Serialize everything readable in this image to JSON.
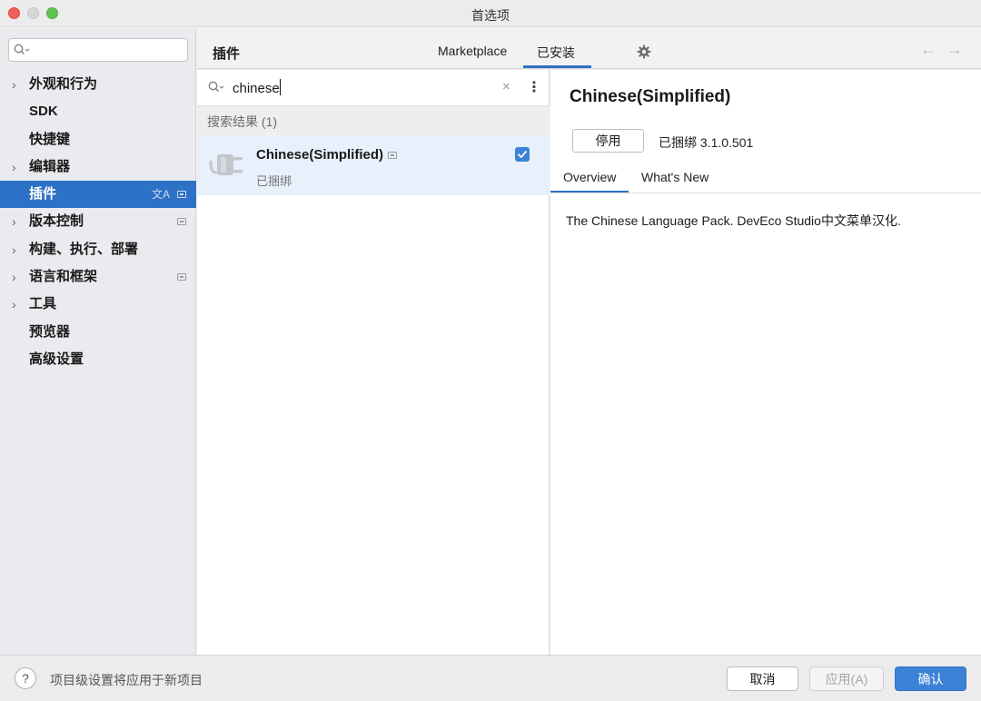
{
  "window": {
    "title": "首选项"
  },
  "sidebar": {
    "search": {
      "value": "",
      "placeholder": ""
    },
    "items": [
      {
        "label": "外观和行为",
        "expandable": true
      },
      {
        "label": "SDK",
        "expandable": false
      },
      {
        "label": "快捷键",
        "expandable": false
      },
      {
        "label": "编辑器",
        "expandable": true
      },
      {
        "label": "插件",
        "expandable": false,
        "selected": true
      },
      {
        "label": "版本控制",
        "expandable": true
      },
      {
        "label": "构建、执行、部署",
        "expandable": true
      },
      {
        "label": "语言和框架",
        "expandable": true
      },
      {
        "label": "工具",
        "expandable": true
      },
      {
        "label": "预览器",
        "expandable": false
      },
      {
        "label": "高级设置",
        "expandable": false
      }
    ]
  },
  "header": {
    "title": "插件",
    "tabs": [
      {
        "label": "Marketplace",
        "active": false
      },
      {
        "label": "已安装",
        "active": true
      }
    ]
  },
  "plugin_list": {
    "search_value": "chinese",
    "results_label": "搜索结果 (1)",
    "items": [
      {
        "name": "Chinese(Simplified)",
        "status": "已捆绑",
        "enabled": true
      }
    ]
  },
  "detail": {
    "title": "Chinese(Simplified)",
    "disable_label": "停用",
    "bundled_version": "已捆绑 3.1.0.501",
    "tabs": [
      {
        "label": "Overview",
        "active": true
      },
      {
        "label": "What's New",
        "active": false
      }
    ],
    "description": "The Chinese Language Pack. DevEco Studio中文菜单汉化."
  },
  "footer": {
    "help_label": "?",
    "hint": "项目级设置将应用于新项目",
    "cancel_label": "取消",
    "apply_label": "应用(A)",
    "ok_label": "确认"
  },
  "colors": {
    "accent": "#2d72c6",
    "selection": "#e7f0fb",
    "close": "#ee5f57",
    "maximize": "#5fc54f"
  },
  "icons": [
    "search-icon",
    "chevron-right-icon",
    "translate-icon",
    "settings-page-icon",
    "gear-icon",
    "back-arrow-icon",
    "forward-arrow-icon",
    "clear-icon",
    "more-vertical-icon",
    "plug-icon",
    "checkbox-checked-icon",
    "help-icon"
  ]
}
